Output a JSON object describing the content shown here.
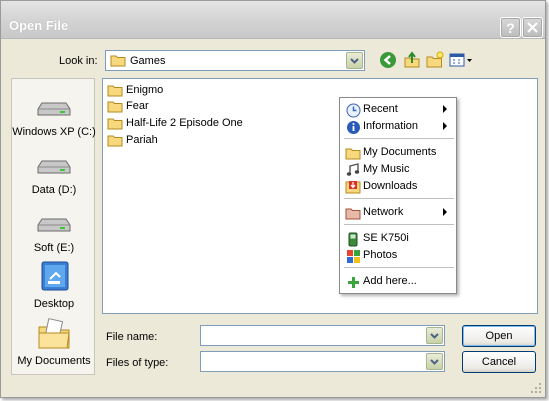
{
  "window": {
    "title": "Open File",
    "help_button": "?",
    "close_button": "✕"
  },
  "lookin": {
    "label": "Look in:",
    "value": "Games"
  },
  "places": [
    {
      "label": "Windows XP (C:)",
      "icon": "hard-drive-icon"
    },
    {
      "label": "Data (D:)",
      "icon": "hard-drive-icon"
    },
    {
      "label": "Soft (E:)",
      "icon": "hard-drive-icon"
    },
    {
      "label": "Desktop",
      "icon": "desktop-icon"
    },
    {
      "label": "My Documents",
      "icon": "my-documents-icon"
    }
  ],
  "files": [
    {
      "label": "Enigmo",
      "icon": "folder-icon"
    },
    {
      "label": "Fear",
      "icon": "folder-icon"
    },
    {
      "label": "Half-Life 2 Episode One",
      "icon": "folder-icon"
    },
    {
      "label": "Pariah",
      "icon": "folder-icon"
    }
  ],
  "menu": {
    "items": [
      {
        "label": "Recent",
        "icon": "recent-icon",
        "submenu": true
      },
      {
        "label": "Information",
        "icon": "info-icon",
        "submenu": true
      },
      {
        "label": "My Documents",
        "icon": "folder-icon",
        "submenu": false
      },
      {
        "label": "My Music",
        "icon": "music-icon",
        "submenu": false
      },
      {
        "label": "Downloads",
        "icon": "downloads-icon",
        "submenu": false
      },
      {
        "label": "Network",
        "icon": "network-folder-icon",
        "submenu": true
      },
      {
        "label": "SE K750i",
        "icon": "phone-icon",
        "submenu": false
      },
      {
        "label": "Photos",
        "icon": "photos-icon",
        "submenu": false
      },
      {
        "label": "Add here...",
        "icon": "add-icon",
        "submenu": false
      }
    ]
  },
  "filename": {
    "label": "File name:",
    "value": ""
  },
  "filetype": {
    "label": "Files of type:",
    "value": ""
  },
  "buttons": {
    "open": "Open",
    "cancel": "Cancel"
  },
  "colors": {
    "dialog_bg": "#ece9d8",
    "accent_border": "#7f9db9",
    "button_border": "#003c74"
  }
}
